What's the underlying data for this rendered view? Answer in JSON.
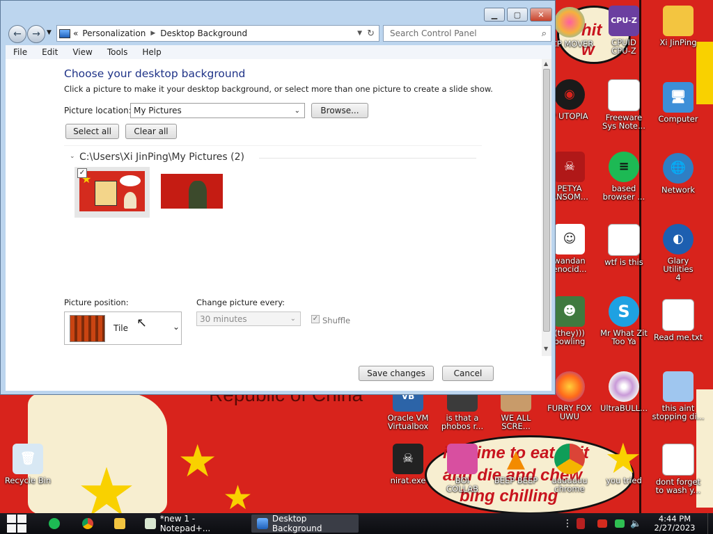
{
  "window": {
    "breadcrumb_root": "Personalization",
    "breadcrumb_current": "Desktop Background",
    "search_placeholder": "Search Control Panel",
    "menu": [
      "File",
      "Edit",
      "View",
      "Tools",
      "Help"
    ],
    "heading": "Choose your desktop background",
    "subheading": "Click a picture to make it your desktop background, or select more than one picture to create a slide show.",
    "picture_location_label": "Picture location:",
    "picture_location_value": "My Pictures",
    "browse_label": "Browse...",
    "select_all_label": "Select all",
    "clear_all_label": "Clear all",
    "folder_label": "C:\\Users\\Xi JinPing\\My Pictures (2)",
    "picture_position_label": "Picture position:",
    "picture_position_value": "Tile",
    "change_every_label": "Change picture every:",
    "change_every_value": "30 minutes",
    "shuffle_label": "Shuffle",
    "save_label": "Save changes",
    "cancel_label": "Cancel"
  },
  "desktop_icons": {
    "ccp_mover": "CCP MOVER",
    "cpuid": "CPUID\nCPU-Z",
    "xi": "Xi JinPing",
    "utopia": "P UTOPIA",
    "freeware": "Freeware\nSys Note...",
    "computer": "Computer",
    "petya": "PETYA\nANSOM...",
    "based": "based\nbrowser ...",
    "network": "Network",
    "rwandan": "wandan\nenocid...",
    "wtf": "wtf is this",
    "glary": "Glary Utilities\n4",
    "bowling": "(they)))\nbowling",
    "skype": "Mr What Zit\nToo Ya",
    "readme": "Read me.txt",
    "oracle": "Oracle VM\nVirtualbox",
    "phobos": "is that a\nphobos r...",
    "weall": "WE ALL\nSCRE...",
    "furry": "FURRY FOX\nUWU",
    "ultrabull": "UltraBULL...",
    "thisaint": "this aint\nstopping di...",
    "recycle": "Recycle Bin",
    "nirat": "nirat.exe",
    "boi": "BOI\nCOLLAB",
    "beep": "BEEP BEEP",
    "uwuchrome": "uuuuuuu\nchrome",
    "youtried": "you tried",
    "dontforget": "dont forget\nto wash y..."
  },
  "wallpaper_text": {
    "top": "hit\nw",
    "country": "Republic of China",
    "meme1": "it's time to eat shit",
    "meme2": "and die and chew",
    "meme3": "bing chilling"
  },
  "taskbar": {
    "notepad": "*new 1 - Notepad+...",
    "desktop_bg": "Desktop Background",
    "time": "4:44 PM",
    "date": "2/27/2023"
  },
  "colors": {
    "wallpaper_red": "#d8231c",
    "star_yellow": "#f9d100",
    "window_frame": "#bcd5ee"
  }
}
